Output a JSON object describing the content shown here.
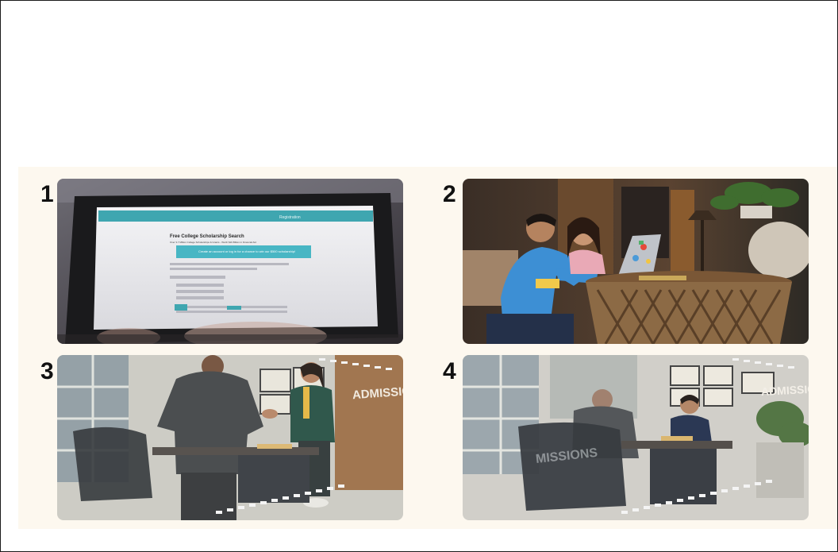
{
  "panels": [
    {
      "number": "1",
      "screen": {
        "heading": "Free College Scholarship Search",
        "subheading": "Over 3.7 Million College Scholarships & Grants - Worth $19 Billion in Financial Aid",
        "banner": "Create an account or log in for a chance to win our $500 scholarship!",
        "nav_right": "Registration"
      }
    },
    {
      "number": "2"
    },
    {
      "number": "3",
      "sign": "ADMISSIONS"
    },
    {
      "number": "4",
      "sign": "ADMISSIONS",
      "reflection": "MISSIONS"
    }
  ]
}
